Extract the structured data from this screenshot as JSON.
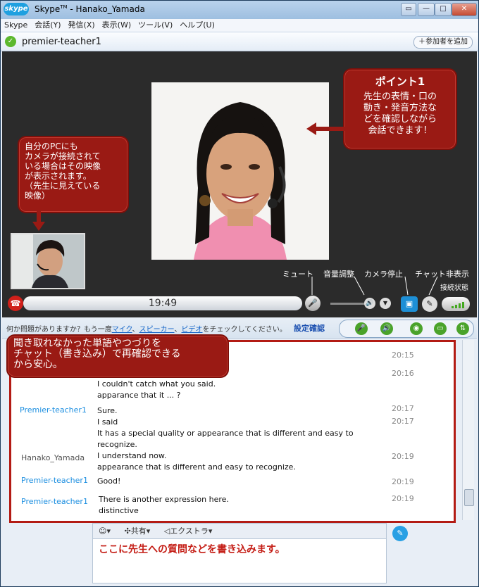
{
  "window": {
    "app_name": "Skype",
    "title_rest": "- Hanako_Yamada",
    "tm": "TM",
    "logo_text": "skype"
  },
  "menu": [
    "Skype",
    "会話(Y)",
    "発信(X)",
    "表示(W)",
    "ツール(V)",
    "ヘルプ(U)"
  ],
  "call": {
    "name": "premier-teacher1",
    "add_participant": "＋参加者を追加",
    "timer": "19:49"
  },
  "annotations": {
    "point1_title": "ポイント1",
    "point1_lines": [
      "先生の表情・口の",
      "動き・発音方法な",
      "どを確認しながら",
      "会話できます！"
    ],
    "self_video_lines": [
      "自分のPCにも",
      "カメラが接続されて",
      "いる場合はその映像",
      "が表示されます。",
      "（先生に見えている",
      "映像）"
    ],
    "chat_note_lines": [
      "聞き取れなかった単語やつづりを",
      "チャット（書き込み）で再確認できる",
      "から安心。"
    ]
  },
  "controls": {
    "mute": "ミュート",
    "volume": "音量調整",
    "camera_stop": "カメラ停止",
    "chat_hide": "チャット非表示",
    "connection": "接続状態"
  },
  "helpbar": {
    "text_prefix": "何か問題がありますか？もう一度",
    "mic": "マイク",
    "sep1": "、",
    "speaker": "スピーカー",
    "sep2": "、",
    "video": "ビデオ",
    "text_suffix": "をチェックしてください。",
    "settings": "設定確認"
  },
  "chat": [
    {
      "sender": "",
      "lines": [],
      "times": [
        "20:15"
      ]
    },
    {
      "sender": "",
      "lines": [
        "I couldn't  catch what you said.",
        "apparance that it ... ?"
      ],
      "times": [
        "20:16"
      ]
    },
    {
      "sender": "Premier-teacher1",
      "lines": [
        "Sure.",
        "I said",
        "It has a special quality or appearance that is different and easy to",
        "recognize."
      ],
      "times": [
        "20:17",
        "20:17"
      ]
    },
    {
      "sender": "Hanako_Yamada",
      "lines": [
        "I understand now.",
        "appearance that is different and easy to recognize."
      ],
      "times": [
        "20:19"
      ]
    },
    {
      "sender": "Premier-teacher1",
      "lines": [
        "Good!"
      ],
      "times": [
        "20:19"
      ]
    },
    {
      "sender": "Premier-teacher1",
      "lines": [
        "There is another expression here.",
        "distinctive"
      ],
      "times": [
        "20:19"
      ]
    }
  ],
  "input": {
    "emoticon": "☺▾",
    "share": "共有▾",
    "extras": "エクストラ▾",
    "text": "ここに先生への質問などを書き込みます。"
  },
  "colors": {
    "accent_red": "#9a1a14",
    "teacher_blue": "#1b8ee0",
    "status_green": "#5cb82d"
  }
}
